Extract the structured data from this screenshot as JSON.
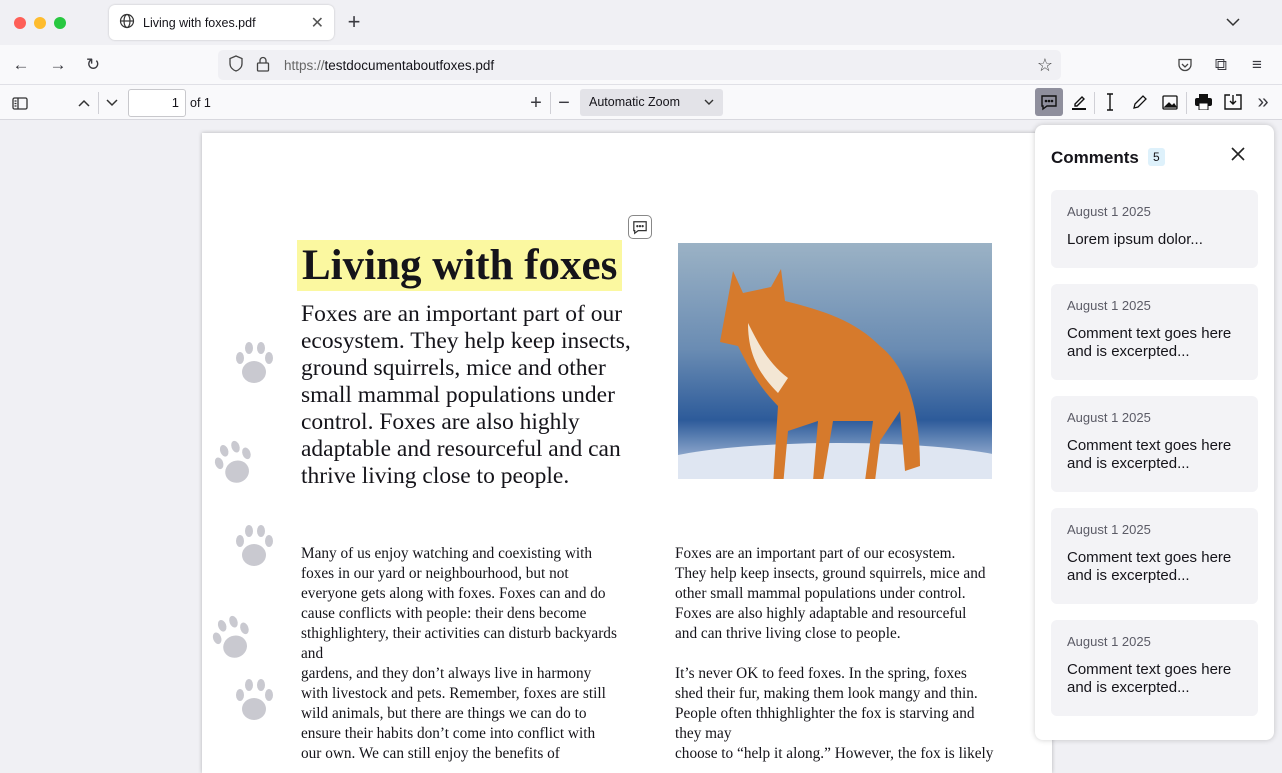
{
  "tab": {
    "title": "Living with foxes.pdf"
  },
  "url": {
    "scheme": "https://",
    "host": "testdocumentaboutfoxes.pdf"
  },
  "pdf_toolbar": {
    "page_number": "1",
    "page_count_label": "of 1",
    "zoom": "Automatic Zoom"
  },
  "document": {
    "title": "Living with foxes",
    "lead": "Foxes are an important part of our ecosystem. They help keep insects, ground squirrels, mice and other small mammal populations under control. Foxes are also highly adaptable and resourceful and can thrive living close to people.",
    "col1": "Many of us enjoy watching and coexisting with\nfoxes in our yard or neighbourhood, but not\neveryone gets along with foxes. Foxes can and do\ncause conflicts with people: their dens become\nsthighlightery, their activities can disturb backyards\nand\ngardens, and they don’t always live in harmony\nwith livestock and pets. Remember, foxes are still\nwild animals, but there are things we can do to\nensure their habits don’t come into conflict with\nour own. We can still enjoy the benefits of",
    "col2": "Foxes are an important part of our ecosystem.\nThey help keep insects, ground squirrels, mice and\nother small mammal populations under control.\nFoxes are also highly adaptable and resourceful\nand can thrive living close to people.\n\nIt’s never OK to feed foxes. In the spring, foxes\nshed their fur, making them look mangy and thin.\nPeople often thhighlighter the fox is starving and\nthey may\nchoose to “help it along.” However, the fox is likely"
  },
  "comments": {
    "title": "Comments",
    "count": "5",
    "items": [
      {
        "date": "August 1 2025",
        "text": "Lorem ipsum dolor..."
      },
      {
        "date": "August 1 2025",
        "text": "Comment text goes here and is excerpted..."
      },
      {
        "date": "August 1 2025",
        "text": "Comment text goes here and is excerpted..."
      },
      {
        "date": "August 1 2025",
        "text": "Comment text goes here and is excerpted..."
      },
      {
        "date": "August 1 2025",
        "text": "Comment text goes here and is excerpted..."
      }
    ]
  }
}
